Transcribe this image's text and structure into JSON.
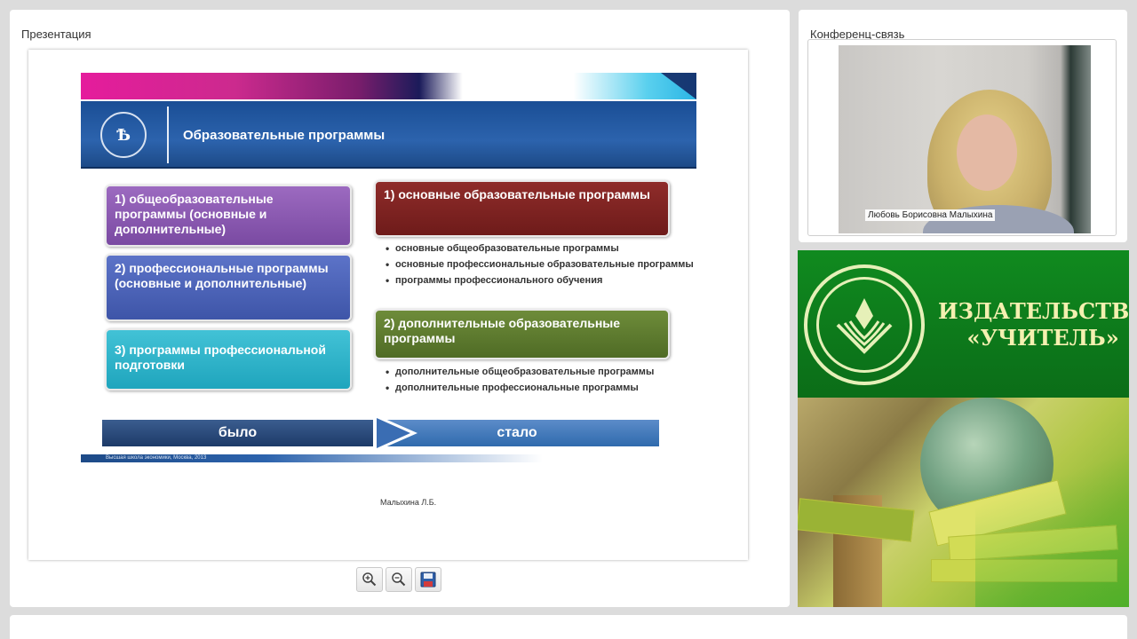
{
  "presentation_panel": {
    "title": "Презентация",
    "slide": {
      "title": "Образовательные программы",
      "left_boxes": [
        "1) общеобразовательные программы (основные и дополнительные)",
        "2) профессиональные программы (основные и дополнительные)",
        "3) программы профессиональной подготовки"
      ],
      "right_box_1": "1) основные образовательные программы",
      "bullets_1": [
        "основные общеобразовательные программы",
        "основные профессиональные образовательные программы",
        "программы профессионального обучения"
      ],
      "right_box_2": "2) дополнительные образовательные программы",
      "bullets_2": [
        "дополнительные общеобразовательные программы",
        "дополнительные профессиональные программы"
      ],
      "was_label": "было",
      "now_label": "стало",
      "footer_text": "Высшая школа экономики, Москва, 2013",
      "author": "Малыхина Л.Б."
    },
    "toolbar": {
      "zoom_in_icon": "zoom-in-icon",
      "zoom_out_icon": "zoom-out-icon",
      "save_icon": "floppy-disk-icon"
    }
  },
  "conference_panel": {
    "title": "Конференц-связь",
    "participant_name": "Любовь Борисовна Малыхина"
  },
  "publisher_banner": {
    "line1": "ИЗДАТЕЛЬСТВО",
    "line2": "«УЧИТЕЛЬ»"
  },
  "colors": {
    "background": "#dcdcdc",
    "banner_green": "#0f7a1e",
    "banner_text": "#f4f0b0"
  }
}
